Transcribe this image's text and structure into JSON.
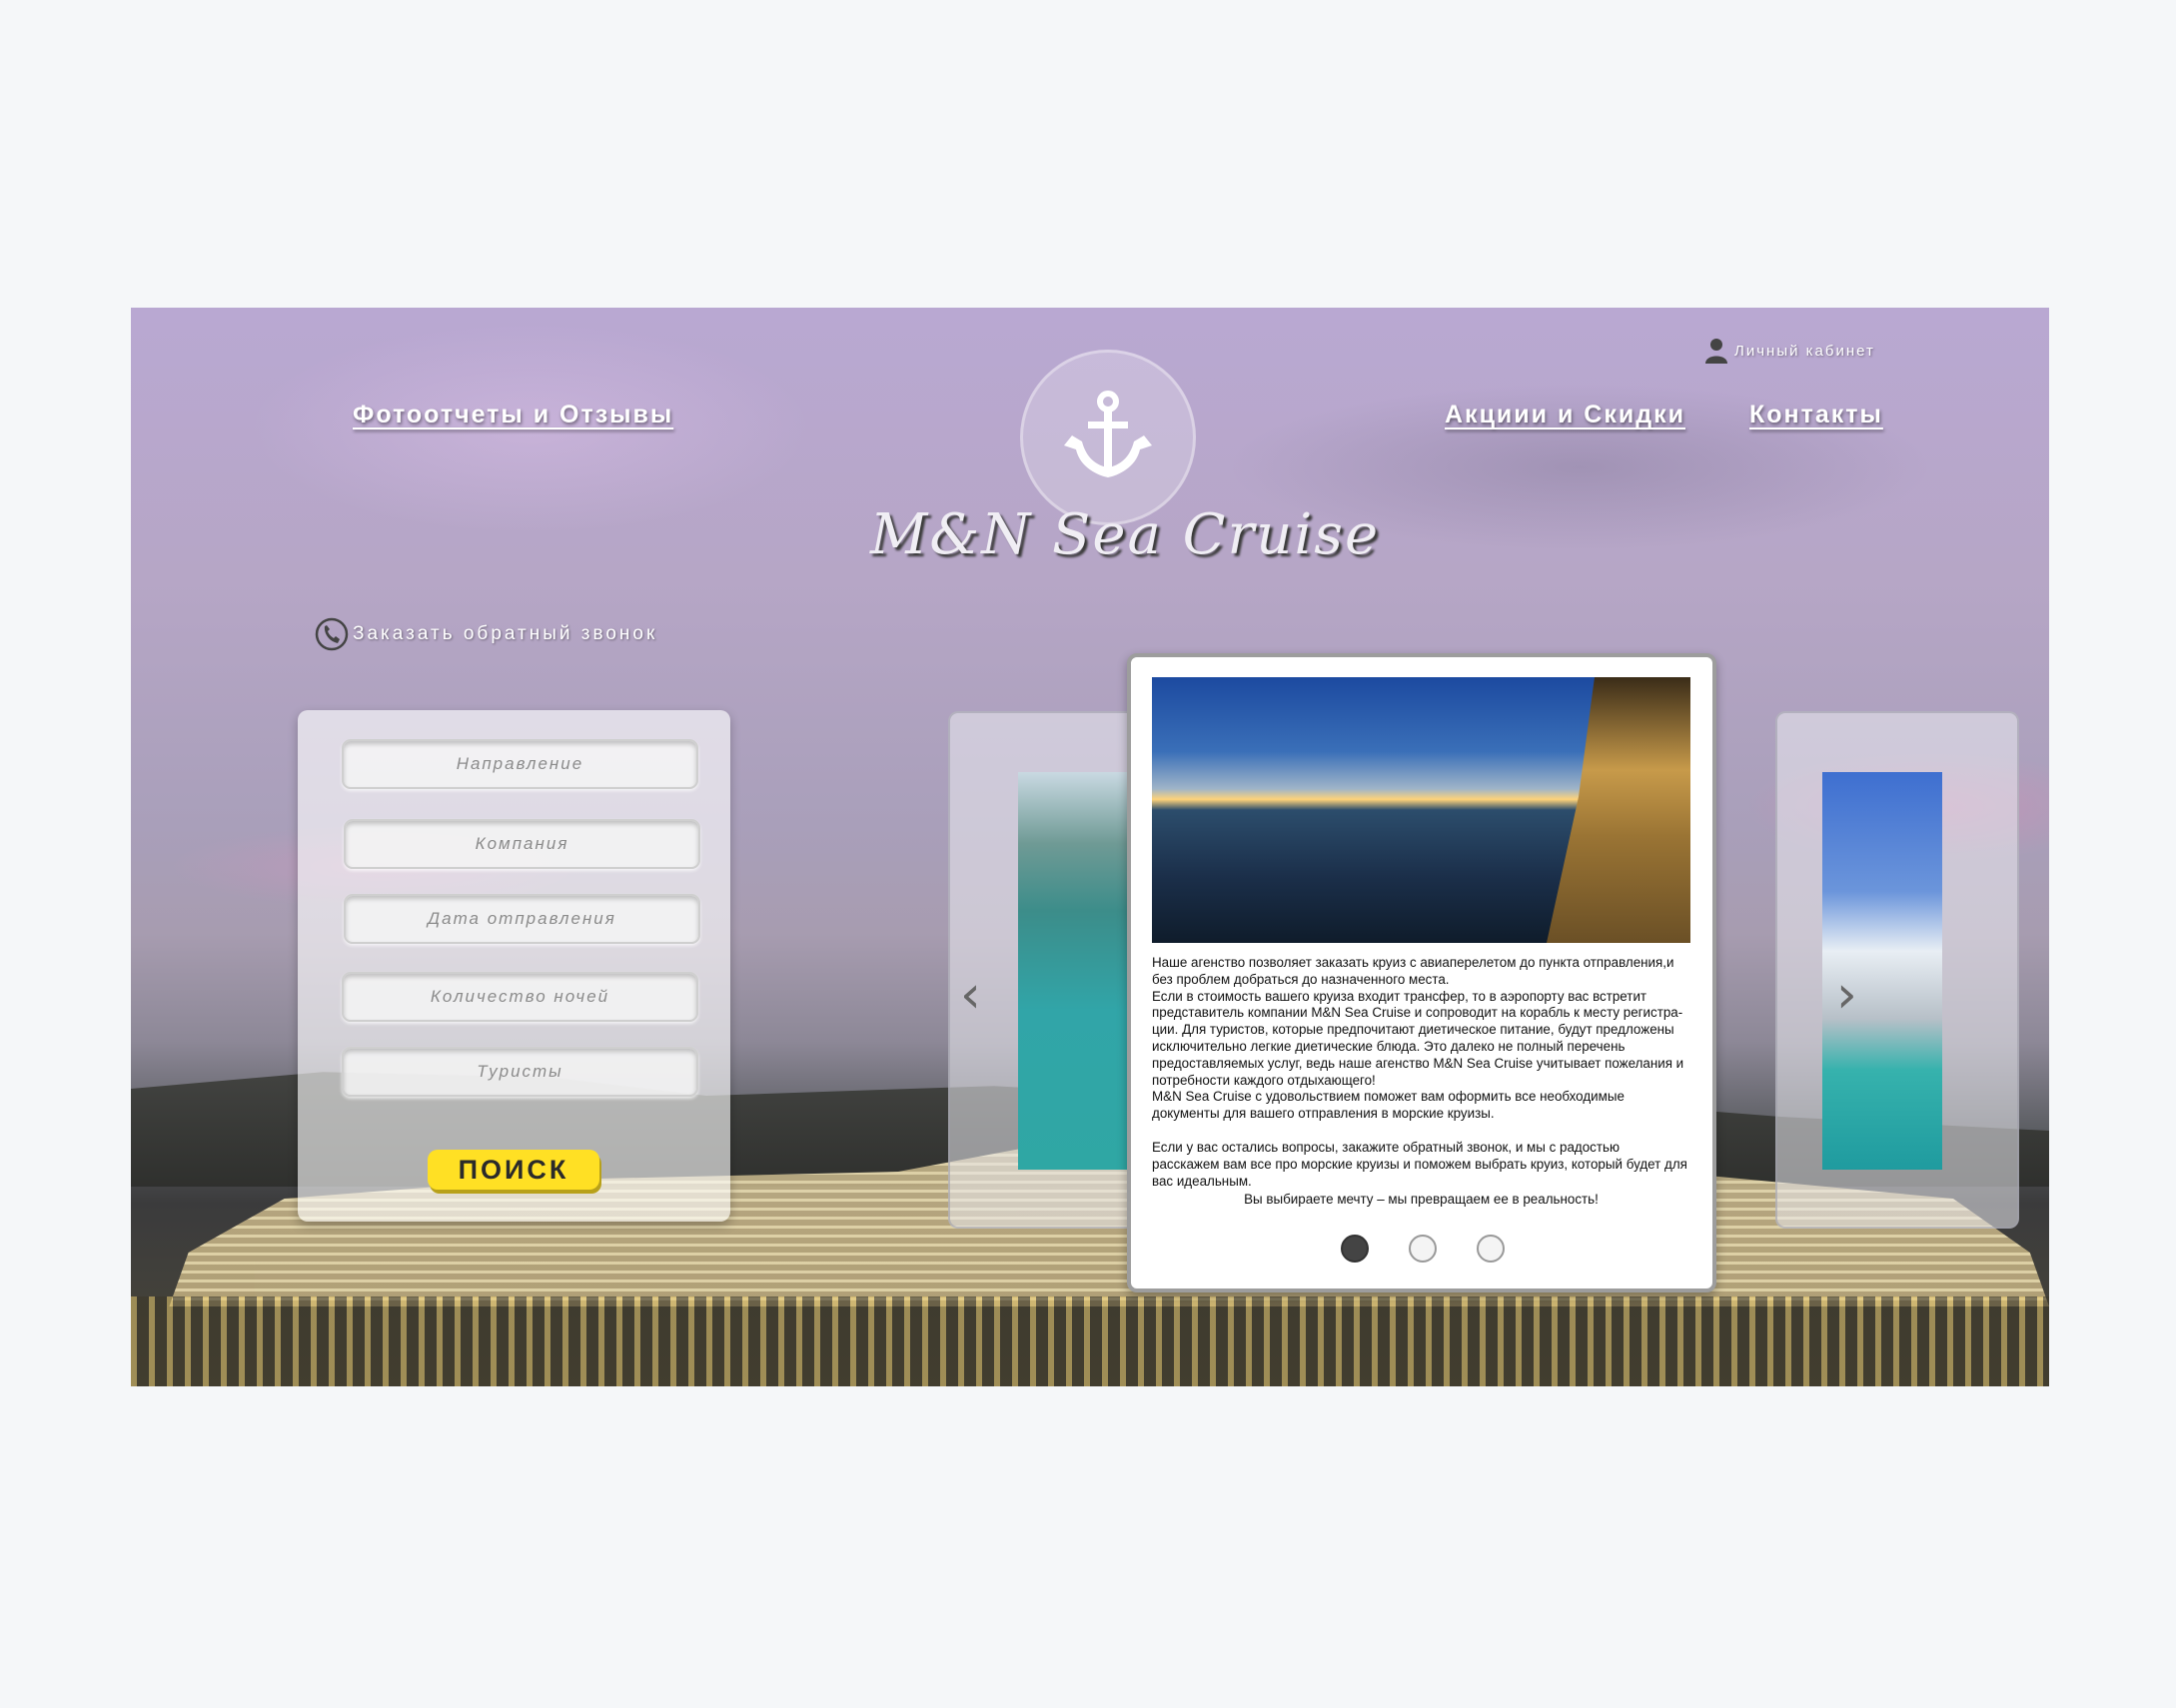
{
  "nav": {
    "photo_reviews": "Фотоотчеты и Отзывы",
    "promotions": "Акциии и Скидки",
    "contacts": "Контакты",
    "account": "Личный кабинет"
  },
  "brand": {
    "name": "M&N Sea Cruise"
  },
  "callback": {
    "label": "Заказать обратный звонок"
  },
  "search": {
    "direction_placeholder": "Направление",
    "company_placeholder": "Компания",
    "date_placeholder": "Дата отправления",
    "nights_placeholder": "Количество ночей",
    "tourists_placeholder": "Туристы",
    "button": "ПОИСК"
  },
  "slider": {
    "p1": "Наше агенство позволяет заказать круиз с авиаперелетом до пункта отправления,и без проблем добраться до назначенного места.",
    "p2": "Если в стоимость вашего круиза входит трансфер, то в аэропорту вас встретит представитель компании M&N Sea Cruise и сопроводит на корабль к месту регистра-ции. Для туристов, которые предпочитают диетическое питание, будут предложены исключительно легкие диетические блюда. Это далеко не полный перечень предоставляемых услуг, ведь наше агенство M&N Sea Cruise учитывает пожелания и потребности каждого отдыхающего!",
    "p3": "M&N Sea Cruise с удовольствием поможет вам оформить все необходимые документы для вашего отправления в морские круизы.",
    "p4": "Если у вас остались вопросы, закажите обратный звонок, и мы с радостью расскажем вам все про морские круизы и поможем выбрать круиз, который будет для вас идеальным.",
    "tagline": "Вы выбираете мечту – мы превращаем ее в реальность!",
    "active_slide": 1
  },
  "icons": {
    "account": "user-icon",
    "logo": "anchor-icon",
    "callback": "phone-icon",
    "prev": "chevron-left-icon",
    "next": "chevron-right-icon"
  },
  "colors": {
    "search_button": "#ffe024",
    "background": "#f5f7f9"
  }
}
